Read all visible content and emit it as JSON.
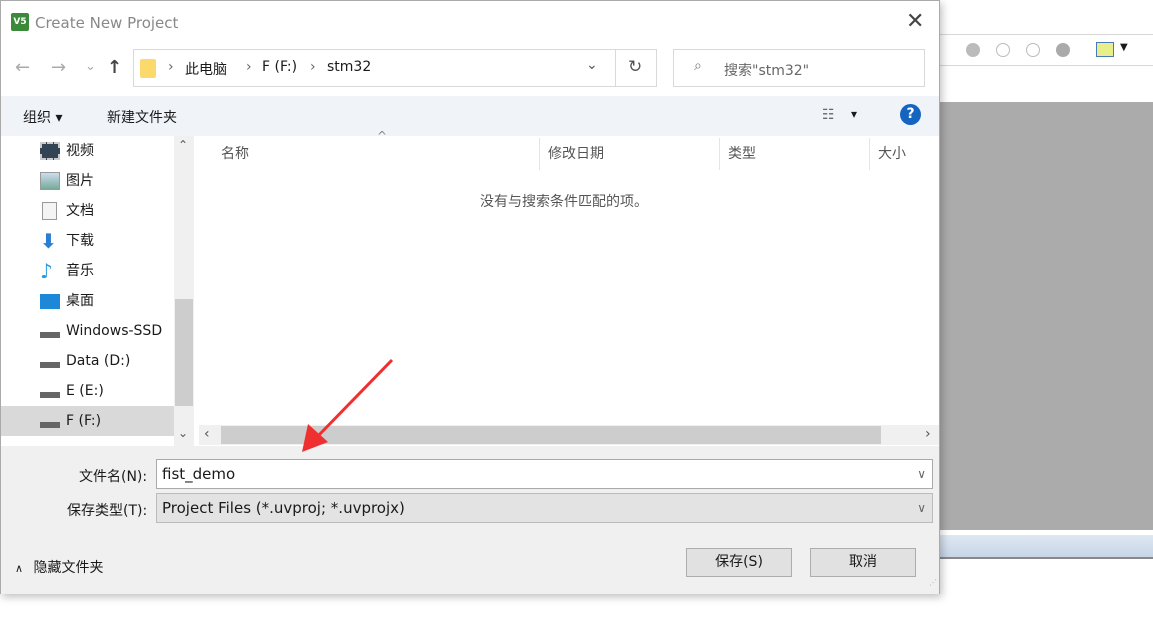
{
  "window": {
    "title": "Create New Project",
    "close": "✕"
  },
  "nav": {
    "back": "←",
    "forward": "→",
    "recent": "⌄",
    "up": "↑",
    "breadcrumb": [
      "此电脑",
      "F (F:)",
      "stm32"
    ],
    "refresh": "↻",
    "search_placeholder": "搜索\"stm32\""
  },
  "toolbar": {
    "organize": "组织 ▾",
    "new_folder": "新建文件夹",
    "view": "▾",
    "help": "?"
  },
  "sidebar": {
    "items": [
      {
        "label": "视频",
        "icon": "video-icon"
      },
      {
        "label": "图片",
        "icon": "pictures-icon"
      },
      {
        "label": "文档",
        "icon": "documents-icon"
      },
      {
        "label": "下载",
        "icon": "download-icon"
      },
      {
        "label": "音乐",
        "icon": "music-icon"
      },
      {
        "label": "桌面",
        "icon": "desktop-icon"
      },
      {
        "label": "Windows-SSD",
        "icon": "drive-icon"
      },
      {
        "label": "Data (D:)",
        "icon": "drive-icon"
      },
      {
        "label": "E (E:)",
        "icon": "drive-icon"
      },
      {
        "label": "F (F:)",
        "icon": "drive-icon",
        "selected": true
      }
    ]
  },
  "filelist": {
    "columns": [
      "名称",
      "修改日期",
      "类型",
      "大小"
    ],
    "empty_message": "没有与搜索条件匹配的项。"
  },
  "form": {
    "filename_label": "文件名(N):",
    "filename_value": "fist_demo",
    "type_label": "保存类型(T):",
    "type_value": "Project Files (*.uvproj; *.uvprojx)"
  },
  "footer": {
    "hide_folders": "隐藏文件夹",
    "save": "保存(S)",
    "cancel": "取消"
  },
  "colors": {
    "annotation_arrow": "#f03030",
    "help_blue": "#1565c0"
  }
}
